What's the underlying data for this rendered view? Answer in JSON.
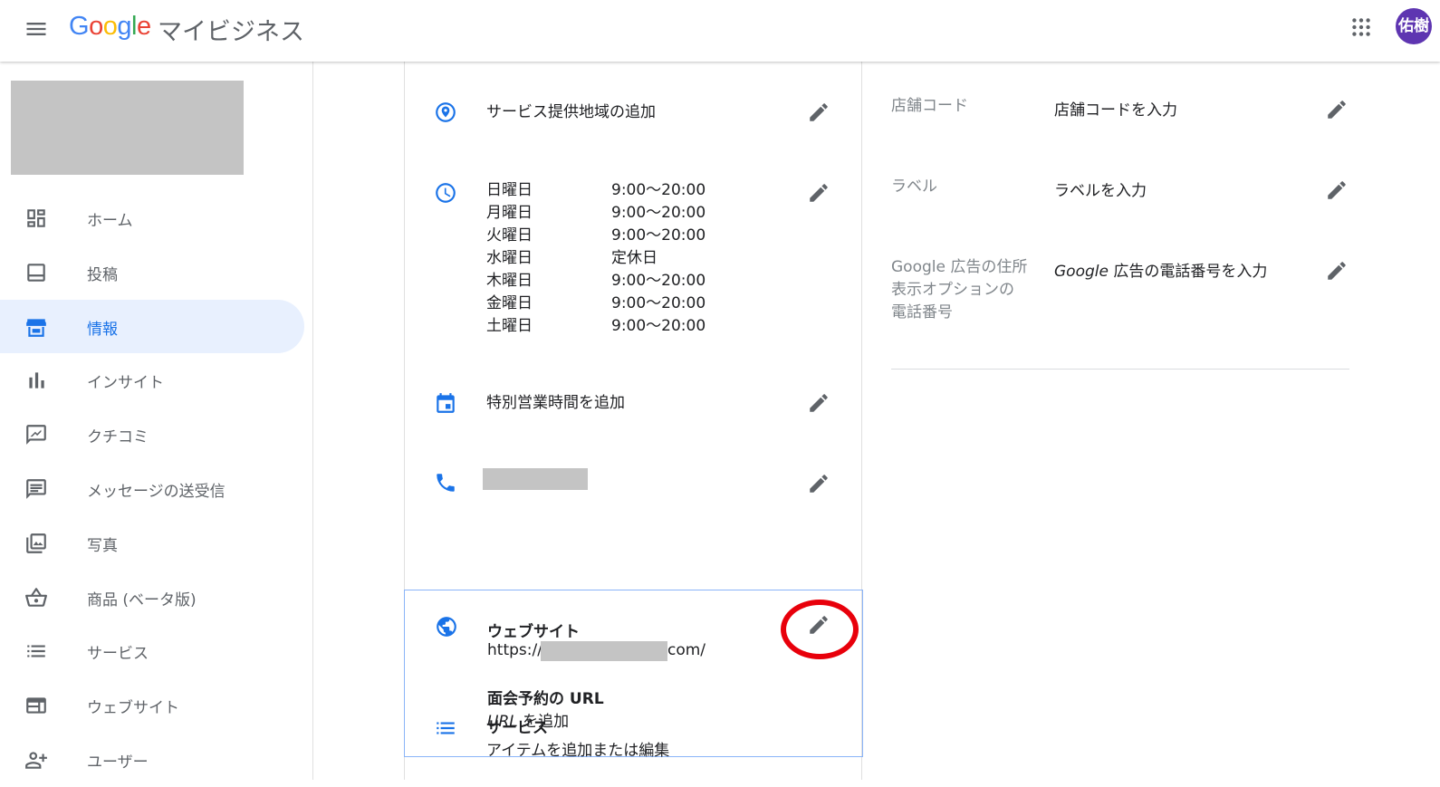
{
  "header": {
    "logo_letters": [
      {
        "ch": "G",
        "color": "#4285F4"
      },
      {
        "ch": "o",
        "color": "#EA4335"
      },
      {
        "ch": "o",
        "color": "#FBBC05"
      },
      {
        "ch": "g",
        "color": "#4285F4"
      },
      {
        "ch": "l",
        "color": "#34A853"
      },
      {
        "ch": "e",
        "color": "#EA4335"
      }
    ],
    "product_name": "マイビジネス",
    "avatar_text": "佑樹",
    "avatar_color": "#5e35b1"
  },
  "sidebar": {
    "items": [
      {
        "label": "ホーム",
        "icon": "dashboard-icon"
      },
      {
        "label": "投稿",
        "icon": "post-icon"
      },
      {
        "label": "情報",
        "icon": "storefront-icon",
        "active": true
      },
      {
        "label": "インサイト",
        "icon": "bar-chart-icon"
      },
      {
        "label": "クチコミ",
        "icon": "review-icon"
      },
      {
        "label": "メッセージの送受信",
        "icon": "message-icon"
      },
      {
        "label": "写真",
        "icon": "photo-library-icon"
      },
      {
        "label": "商品 (ベータ版)",
        "icon": "basket-icon"
      },
      {
        "label": "サービス",
        "icon": "list-icon"
      },
      {
        "label": "ウェブサイト",
        "icon": "web-icon"
      },
      {
        "label": "ユーザー",
        "icon": "add-user-icon"
      }
    ]
  },
  "info": {
    "service_area": "サービス提供地域の追加",
    "hours": [
      {
        "day": "日曜日",
        "time": "9:00～20:00"
      },
      {
        "day": "月曜日",
        "time": "9:00～20:00"
      },
      {
        "day": "火曜日",
        "time": "9:00～20:00"
      },
      {
        "day": "水曜日",
        "time": "定休日"
      },
      {
        "day": "木曜日",
        "time": "9:00～20:00"
      },
      {
        "day": "金曜日",
        "time": "9:00～20:00"
      },
      {
        "day": "土曜日",
        "time": "9:00～20:00"
      }
    ],
    "special_hours": "特別営業時間を追加",
    "website_title": "ウェブサイト",
    "website_prefix": "https://",
    "website_suffix": "com/",
    "appointment_title": "面会予約の URL",
    "appointment_italic": "URL",
    "appointment_rest": " を追加",
    "services_title": "サービス",
    "services_sub": "アイテムを追加または編集"
  },
  "attributes": {
    "store_code_label": "店舗コード",
    "store_code_value": "店舗コードを入力",
    "labels_label": "ラベル",
    "labels_value": "ラベルを入力",
    "ads_phone_label_1": "Google 広告の住所",
    "ads_phone_label_2": "表示オプションの",
    "ads_phone_label_3": "電話番号",
    "ads_phone_value_italic": "Google",
    "ads_phone_value_rest": " 広告の電話番号を入力"
  },
  "colors": {
    "accent": "#1a73e8",
    "highlight_circle": "#e8000b"
  }
}
